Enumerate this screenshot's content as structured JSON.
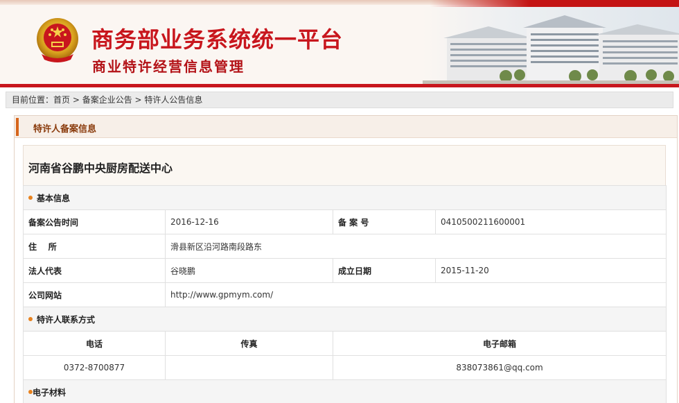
{
  "header": {
    "title": "商务部业务系统统一平台",
    "subtitle": "商业特许经营信息管理",
    "brand_color": "#c8161d"
  },
  "breadcrumb": {
    "prefix": "目前位置：",
    "items": [
      "首页",
      "备案企业公告",
      "特许人公告信息"
    ],
    "separator": " > "
  },
  "panel": {
    "heading": "特许人备案信息",
    "company_name": "河南省谷鹏中央厨房配送中心",
    "basic": {
      "section_title": "基本信息",
      "announce_time_label": "备案公告时间",
      "announce_time": "2016-12-16",
      "record_no_label": "备 案 号",
      "record_no": "0410500211600001",
      "address_label": "住    所",
      "address": "滑县新区沿河路南段路东",
      "legal_rep_label": "法人代表",
      "legal_rep": "谷晓鹏",
      "founded_label": "成立日期",
      "founded": "2015-11-20",
      "website_label": "公司网站",
      "website": "http://www.gpmym.com/"
    },
    "contact": {
      "section_title": "特许人联系方式",
      "phone_header": "电话",
      "fax_header": "传真",
      "email_header": "电子邮箱",
      "phone": "0372-8700877",
      "fax": "",
      "email": "838073861@qq.com"
    },
    "materials": {
      "section_title": "电子材料"
    }
  }
}
